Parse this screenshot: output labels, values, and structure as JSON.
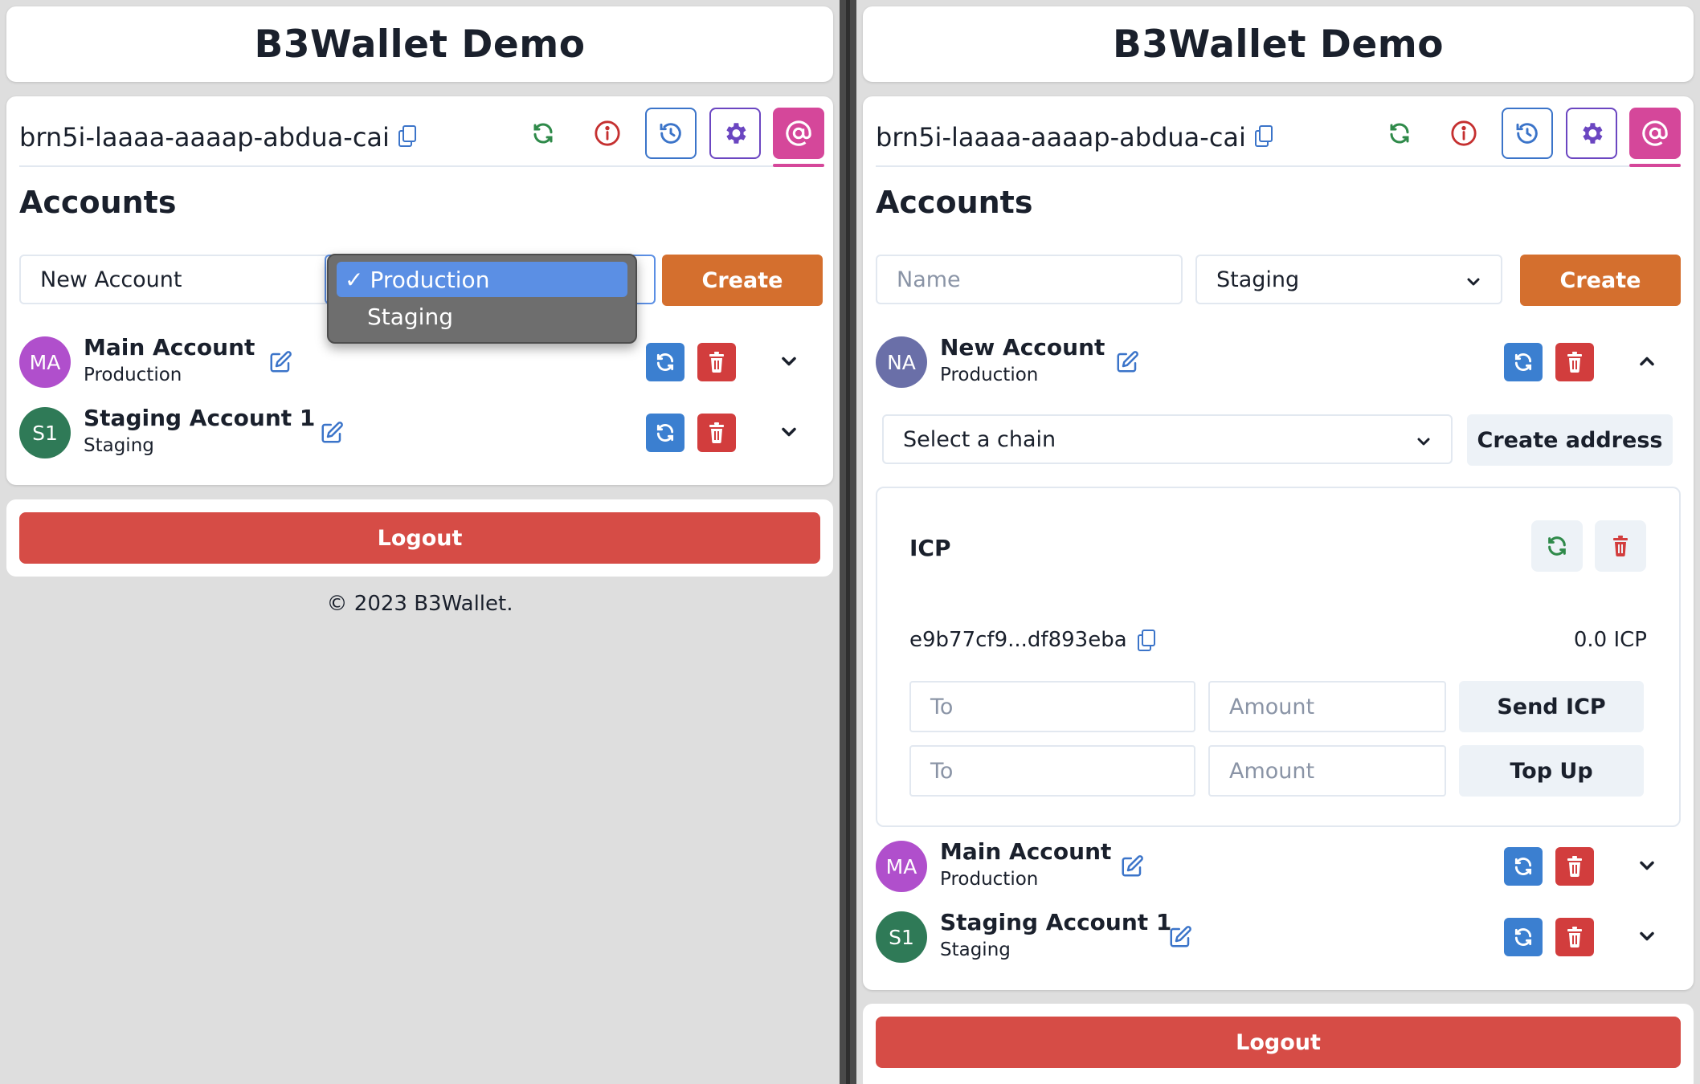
{
  "app": {
    "title": "B3Wallet Demo"
  },
  "principal": "brn5i-laaaa-aaaap-abdua-cai",
  "accounts_title": "Accounts",
  "left": {
    "new_account_value": "New Account",
    "env_options": [
      "Production",
      "Staging"
    ],
    "selected_env": "Production",
    "check_mark": "✓",
    "create_label": "Create",
    "accounts": [
      {
        "initials": "MA",
        "name": "Main Account",
        "env": "Production",
        "color": "#b04fcc"
      },
      {
        "initials": "S1",
        "name": "Staging Account 1",
        "env": "Staging",
        "color": "#2f7a57"
      }
    ],
    "logout_label": "Logout",
    "footer": "© 2023 B3Wallet."
  },
  "right": {
    "name_placeholder": "Name",
    "selected_env": "Staging",
    "create_label": "Create",
    "accounts": [
      {
        "initials": "NA",
        "name": "New Account",
        "env": "Production",
        "color": "#6a6fa8"
      },
      {
        "initials": "MA",
        "name": "Main Account",
        "env": "Production",
        "color": "#b04fcc"
      },
      {
        "initials": "S1",
        "name": "Staging Account 1",
        "env": "Staging",
        "color": "#2f7a57"
      }
    ],
    "chain_select_placeholder": "Select a chain",
    "create_address_label": "Create address",
    "chain": {
      "name": "ICP",
      "address": "e9b77cf9...df893eba",
      "balance": "0.0 ICP",
      "to_placeholder": "To",
      "amount_placeholder": "Amount",
      "send_label": "Send ICP",
      "topup_label": "Top Up"
    },
    "logout_label": "Logout"
  },
  "colors": {
    "accent_orange": "#d46f2e",
    "logout_red": "#d64c46",
    "pink": "#d5479a",
    "blue": "#3b74c9",
    "purple": "#6b46c1"
  },
  "icons": [
    "copy-icon",
    "refresh-icon",
    "info-icon",
    "history-icon",
    "gear-icon",
    "at-icon",
    "edit-icon",
    "trash-icon",
    "chevron-down-icon",
    "chevron-up-icon"
  ]
}
